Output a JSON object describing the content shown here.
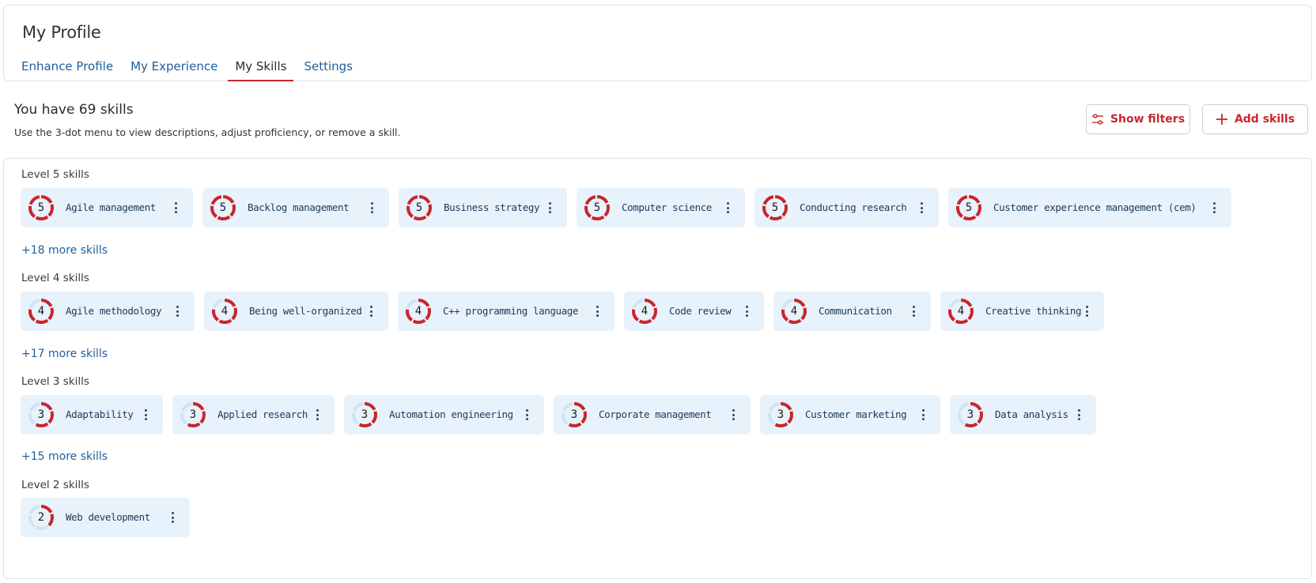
{
  "header": {
    "title": "My Profile",
    "tabs": [
      {
        "label": "Enhance Profile",
        "active": false
      },
      {
        "label": "My Experience",
        "active": false
      },
      {
        "label": "My Skills",
        "active": true
      },
      {
        "label": "Settings",
        "active": false
      }
    ]
  },
  "summary": {
    "title": "You have 69 skills",
    "subtitle": "Use the 3-dot menu to view descriptions, adjust proficiency, or remove a skill."
  },
  "actions": {
    "show_filters": "Show filters",
    "add_skills": "Add skills"
  },
  "colors": {
    "accent": "#c8262b",
    "link": "#1f5f9b",
    "chip_bg": "#e8f2fb",
    "ring_track": "#cfe3f4"
  },
  "levels": [
    {
      "title": "Level 5 skills",
      "level": 5,
      "more": "+18 more skills",
      "skills": [
        "Agile management",
        "Backlog management",
        "Business strategy",
        "Computer science",
        "Conducting research",
        "Customer experience management (cem)"
      ]
    },
    {
      "title": "Level 4 skills",
      "level": 4,
      "more": "+17 more skills",
      "skills": [
        "Agile methodology",
        "Being well-organized",
        "C++ programming language",
        "Code review",
        "Communication",
        "Creative thinking"
      ]
    },
    {
      "title": "Level 3 skills",
      "level": 3,
      "more": "+15 more skills",
      "skills": [
        "Adaptability",
        "Applied research",
        "Automation engineering",
        "Corporate management",
        "Customer marketing",
        "Data analysis"
      ]
    },
    {
      "title": "Level 2 skills",
      "level": 2,
      "more": "",
      "skills": [
        "Web development"
      ]
    }
  ]
}
